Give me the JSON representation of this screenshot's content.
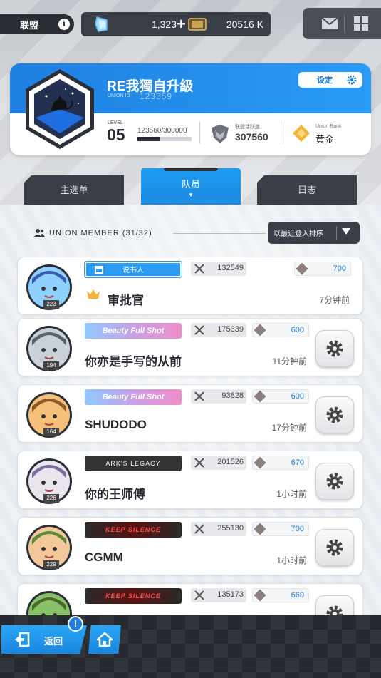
{
  "top_bar": {
    "union_label": "联盟",
    "info_icon": "info-icon",
    "gems": "1,323",
    "gem_plus": "+",
    "tickets": "20516 K"
  },
  "union_card": {
    "name": "RE我獨自升級",
    "id_label": "UNION ID",
    "id": "123359",
    "settings_label": "设定",
    "level_label": "LEVEL",
    "level": "05",
    "exp_text": "123560/300000",
    "exp_fraction": 0.41,
    "activity_label": "联盟活跃度",
    "activity": "307560",
    "rank_label": "Union Rank",
    "rank": "黄金"
  },
  "tabs": [
    {
      "label": "主选单"
    },
    {
      "label": "队员"
    },
    {
      "label": "日志"
    }
  ],
  "member_header": {
    "title": "UNION MEMBER (31/32)",
    "sort_label": "以最近登入排序"
  },
  "members": [
    {
      "level": "223",
      "banner": "说书人",
      "banner_type": "role",
      "power": "132549",
      "points": "700",
      "name": "审批官",
      "time": "7分钟前",
      "is_leader": true
    },
    {
      "level": "194",
      "banner": "Beauty Full Shot",
      "banner_type": "beauty",
      "power": "175339",
      "points": "600",
      "name": "你亦是手写的从前",
      "time": "11分钟前",
      "is_leader": false
    },
    {
      "level": "164",
      "banner": "Beauty Full Shot",
      "banner_type": "beauty",
      "power": "93828",
      "points": "600",
      "name": "SHUDODO",
      "time": "17分钟前",
      "is_leader": false
    },
    {
      "level": "226",
      "banner": "ARK'S LEGACY",
      "banner_type": "ark",
      "power": "201526",
      "points": "670",
      "name": "你的王师傅",
      "time": "1小时前",
      "is_leader": false
    },
    {
      "level": "229",
      "banner": "KEEP SILENCE",
      "banner_type": "keep",
      "power": "255130",
      "points": "700",
      "name": "CGMM",
      "time": "1小时前",
      "is_leader": false
    },
    {
      "level": "",
      "banner": "KEEP SILENCE",
      "banner_type": "keep",
      "power": "135173",
      "points": "660",
      "name": "",
      "time": "",
      "is_leader": false
    }
  ],
  "bottom": {
    "back_label": "返回",
    "alert": "!"
  },
  "colors": {
    "accent_blue": "#1e7fe0",
    "dark_panel": "#3a3e46"
  }
}
